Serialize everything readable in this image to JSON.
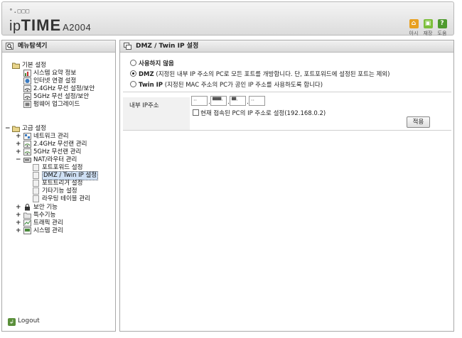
{
  "header": {
    "logo_dots": "°.□□□",
    "logo_prefix": "ip",
    "logo_brand": "TIME",
    "logo_model": "A2004",
    "buttons": [
      {
        "label": "아시",
        "icon": "home-icon",
        "color": "#e8a020"
      },
      {
        "label": "재장",
        "icon": "save-icon",
        "color": "#7cbf3a"
      },
      {
        "label": "도움",
        "icon": "help-icon",
        "color": "#4e9a2e"
      }
    ]
  },
  "sidebar": {
    "title": "메뉴탐색기",
    "basic": {
      "label": "기본 설정",
      "items": [
        "시스템 요약 정보",
        "인터넷 연결 설정",
        "2.4GHz 무선 설정/보안",
        "5GHz 무선 설정/보안",
        "펌웨어 업그레이드"
      ]
    },
    "advanced": {
      "label": "고급 설정",
      "groups": [
        {
          "label": "네트워크 관리"
        },
        {
          "label": "2.4GHz 무선랜 관리"
        },
        {
          "label": "5GHz 무선랜 관리"
        },
        {
          "label": "NAT/라우터 관리",
          "children": [
            "포트포워드 설정",
            "DMZ / Twin IP 설정",
            "포트트리거 설정",
            "기타기능 설정",
            "라우팅 테이블 관리"
          ]
        },
        {
          "label": "보안 기능"
        },
        {
          "label": "특수기능"
        },
        {
          "label": "트래픽 관리"
        },
        {
          "label": "시스템 관리"
        }
      ]
    },
    "logout": "Logout"
  },
  "main": {
    "title": "DMZ / Twin IP 설정",
    "options": [
      {
        "label": "사용하지 않음",
        "desc": "",
        "selected": false
      },
      {
        "label": "DMZ",
        "desc": " (지정된 내부 IP 주소의 PC로 모든 포트를 개방합니다. 단, 포트포워드에 설정된 포트는 제외)",
        "selected": true
      },
      {
        "label": "Twin IP",
        "desc": " (지정된 MAC 주소의 PC가 공인 IP 주소를 사용하도록 합니다)",
        "selected": false
      }
    ],
    "ip_label": "내부 IP주소",
    "ip_octets": [
      "··",
      "▀▀·",
      "▀·",
      "··"
    ],
    "checkbox_label": "현재 접속된 PC의 IP 주소로 설정(192.168.0.2)",
    "apply_label": "적용"
  }
}
